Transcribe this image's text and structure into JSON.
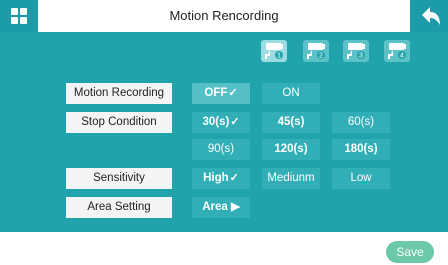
{
  "header": {
    "title": "Motion Rencording"
  },
  "cameras": [
    {
      "name": "camera-1",
      "badge": "1",
      "active": true
    },
    {
      "name": "camera-2",
      "badge": "2",
      "active": false
    },
    {
      "name": "camera-3",
      "badge": "3",
      "active": false
    },
    {
      "name": "camera-4",
      "badge": "4",
      "active": false
    }
  ],
  "settings": {
    "motion_recording": {
      "label": "Motion Recording",
      "options": [
        "OFF",
        "ON"
      ],
      "selected": "OFF"
    },
    "stop_condition": {
      "label": "Stop Condition",
      "options": [
        "30(s)",
        "45(s)",
        "60(s)",
        "90(s)",
        "120(s)",
        "180(s)"
      ],
      "selected": "30(s)"
    },
    "sensitivity": {
      "label": "Sensitivity",
      "options": [
        "High",
        "Mediunm",
        "Low"
      ],
      "selected": "High"
    },
    "area_setting": {
      "label": "Area Setting",
      "button": "Area ▶"
    }
  },
  "footer": {
    "save_label": "Save"
  },
  "colors": {
    "accent": "#21a3ac",
    "header_button": "#1b9ca6",
    "save": "#6cc9a8",
    "label_bg": "#f3f4f4"
  },
  "icons": {
    "home": "grid-icon",
    "back": "back-arrow-icon",
    "camera": "camera-icon",
    "check": "checkmark-icon"
  }
}
